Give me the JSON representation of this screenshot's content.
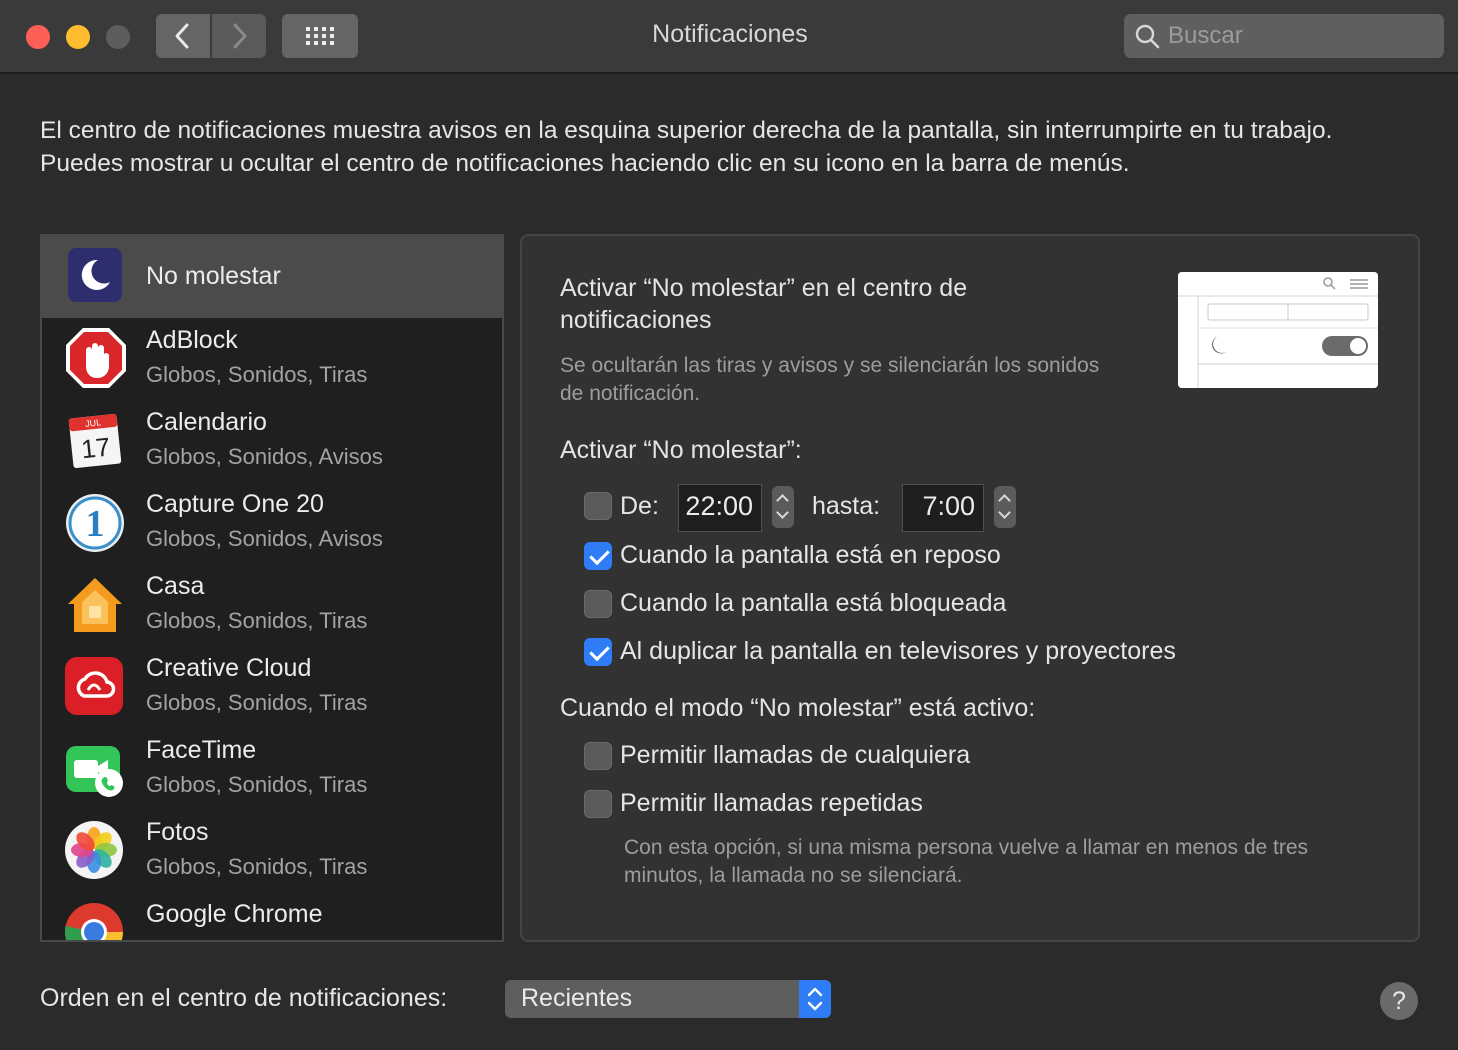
{
  "window": {
    "title": "Notificaciones"
  },
  "search": {
    "placeholder": "Buscar"
  },
  "intro": "El centro de notificaciones muestra avisos en la esquina superior derecha de la pantalla, sin interrumpirte en tu trabajo. Puedes mostrar u ocultar el centro de notificaciones haciendo clic en su icono en la barra de menús.",
  "apps": [
    {
      "name": "No molestar",
      "sub": "",
      "icon": "moon-icon"
    },
    {
      "name": "AdBlock",
      "sub": "Globos, Sonidos, Tiras",
      "icon": "adblock-icon"
    },
    {
      "name": "Calendario",
      "sub": "Globos, Sonidos, Avisos",
      "icon": "calendar-icon",
      "icon_month": "JUL",
      "icon_day": "17"
    },
    {
      "name": "Capture One 20",
      "sub": "Globos, Sonidos, Avisos",
      "icon": "capture-one-icon",
      "icon_text": "1"
    },
    {
      "name": "Casa",
      "sub": "Globos, Sonidos, Tiras",
      "icon": "home-icon"
    },
    {
      "name": "Creative Cloud",
      "sub": "Globos, Sonidos, Tiras",
      "icon": "creative-cloud-icon"
    },
    {
      "name": "FaceTime",
      "sub": "Globos, Sonidos, Tiras",
      "icon": "facetime-icon"
    },
    {
      "name": "Fotos",
      "sub": "Globos, Sonidos, Tiras",
      "icon": "photos-icon"
    },
    {
      "name": "Google Chrome",
      "sub": "",
      "icon": "chrome-icon"
    }
  ],
  "dnd": {
    "activate_title": "Activar “No molestar” en el centro de notificaciones",
    "activate_note": "Se ocultarán las tiras y avisos y se silenciarán los sonidos de notificación.",
    "schedule_title": "Activar “No molestar”:",
    "from_label": "De:",
    "from_time": "22:00",
    "until_label": "hasta:",
    "until_time": "7:00",
    "from_checked": false,
    "options": [
      {
        "label": "Cuando la pantalla está en reposo",
        "checked": true
      },
      {
        "label": "Cuando la pantalla está bloqueada",
        "checked": false
      },
      {
        "label": "Al duplicar la pantalla en televisores y proyectores",
        "checked": true
      }
    ],
    "active_title": "Cuando el modo “No molestar” está activo:",
    "calls": [
      {
        "label": "Permitir llamadas de cualquiera",
        "checked": false
      },
      {
        "label": "Permitir llamadas repetidas",
        "checked": false
      }
    ],
    "calls_note": "Con esta opción, si una misma persona vuelve a llamar en menos de tres minutos, la llamada no se silenciará."
  },
  "order": {
    "label": "Orden en el centro de notificaciones:",
    "value": "Recientes"
  },
  "help": {
    "label": "?"
  }
}
